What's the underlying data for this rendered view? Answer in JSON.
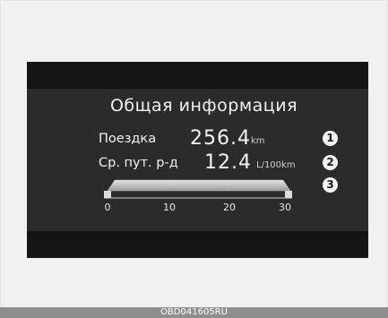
{
  "display": {
    "title": "Общая информация",
    "rows": [
      {
        "label": "Поездка",
        "value": "256.4",
        "unit": "km",
        "badge": "1"
      },
      {
        "label": "Ср. пут. р-д",
        "value": "12.4",
        "unit": "L/100km",
        "badge": "2"
      }
    ],
    "gauge": {
      "badge": "3",
      "ticks": [
        "0",
        "10",
        "20",
        "30"
      ]
    }
  },
  "caption": "OBD041605RU"
}
